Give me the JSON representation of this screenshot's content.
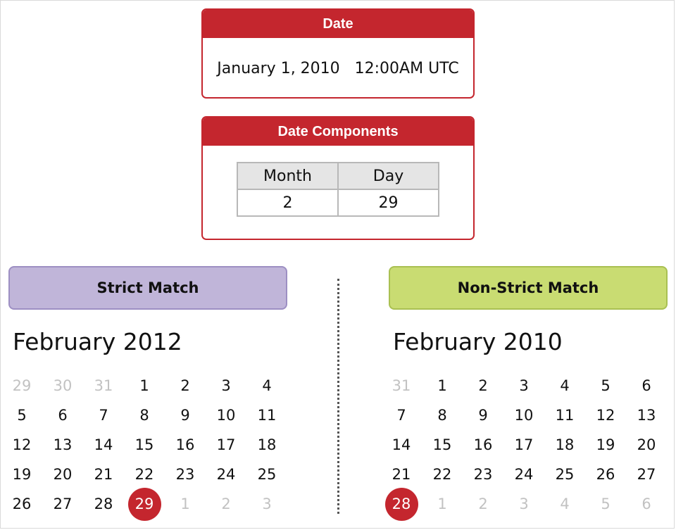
{
  "date_box": {
    "title": "Date",
    "value": "January 1, 2010   12:00AM UTC"
  },
  "components_box": {
    "title": "Date Components",
    "headers": [
      "Month",
      "Day"
    ],
    "values": [
      "2",
      "29"
    ]
  },
  "strict": {
    "label": "Strict Match",
    "month_title": "February 2012",
    "days": [
      {
        "n": "29",
        "muted": true
      },
      {
        "n": "30",
        "muted": true
      },
      {
        "n": "31",
        "muted": true
      },
      {
        "n": "1"
      },
      {
        "n": "2"
      },
      {
        "n": "3"
      },
      {
        "n": "4"
      },
      {
        "n": "5"
      },
      {
        "n": "6"
      },
      {
        "n": "7"
      },
      {
        "n": "8"
      },
      {
        "n": "9"
      },
      {
        "n": "10"
      },
      {
        "n": "11"
      },
      {
        "n": "12"
      },
      {
        "n": "13"
      },
      {
        "n": "14"
      },
      {
        "n": "15"
      },
      {
        "n": "16"
      },
      {
        "n": "17"
      },
      {
        "n": "18"
      },
      {
        "n": "19"
      },
      {
        "n": "20"
      },
      {
        "n": "21"
      },
      {
        "n": "22"
      },
      {
        "n": "23"
      },
      {
        "n": "24"
      },
      {
        "n": "25"
      },
      {
        "n": "26"
      },
      {
        "n": "27"
      },
      {
        "n": "28"
      },
      {
        "n": "29",
        "selected": true
      },
      {
        "n": "1",
        "muted": true
      },
      {
        "n": "2",
        "muted": true
      },
      {
        "n": "3",
        "muted": true
      }
    ]
  },
  "nonstrict": {
    "label": "Non-Strict Match",
    "month_title": "February 2010",
    "days": [
      {
        "n": "31",
        "muted": true
      },
      {
        "n": "1"
      },
      {
        "n": "2"
      },
      {
        "n": "3"
      },
      {
        "n": "4"
      },
      {
        "n": "5"
      },
      {
        "n": "6"
      },
      {
        "n": "7"
      },
      {
        "n": "8"
      },
      {
        "n": "9"
      },
      {
        "n": "10"
      },
      {
        "n": "11"
      },
      {
        "n": "12"
      },
      {
        "n": "13"
      },
      {
        "n": "14"
      },
      {
        "n": "15"
      },
      {
        "n": "16"
      },
      {
        "n": "17"
      },
      {
        "n": "18"
      },
      {
        "n": "19"
      },
      {
        "n": "20"
      },
      {
        "n": "21"
      },
      {
        "n": "22"
      },
      {
        "n": "23"
      },
      {
        "n": "24"
      },
      {
        "n": "25"
      },
      {
        "n": "26"
      },
      {
        "n": "27"
      },
      {
        "n": "28",
        "selected": true
      },
      {
        "n": "1",
        "muted": true
      },
      {
        "n": "2",
        "muted": true
      },
      {
        "n": "3",
        "muted": true
      },
      {
        "n": "4",
        "muted": true
      },
      {
        "n": "5",
        "muted": true
      },
      {
        "n": "6",
        "muted": true
      }
    ]
  },
  "colors": {
    "accent_red": "#c4262e",
    "strict_fill": "#c0b5d9",
    "nonstrict_fill": "#c9dc72",
    "muted_text": "#c2c2c2"
  }
}
